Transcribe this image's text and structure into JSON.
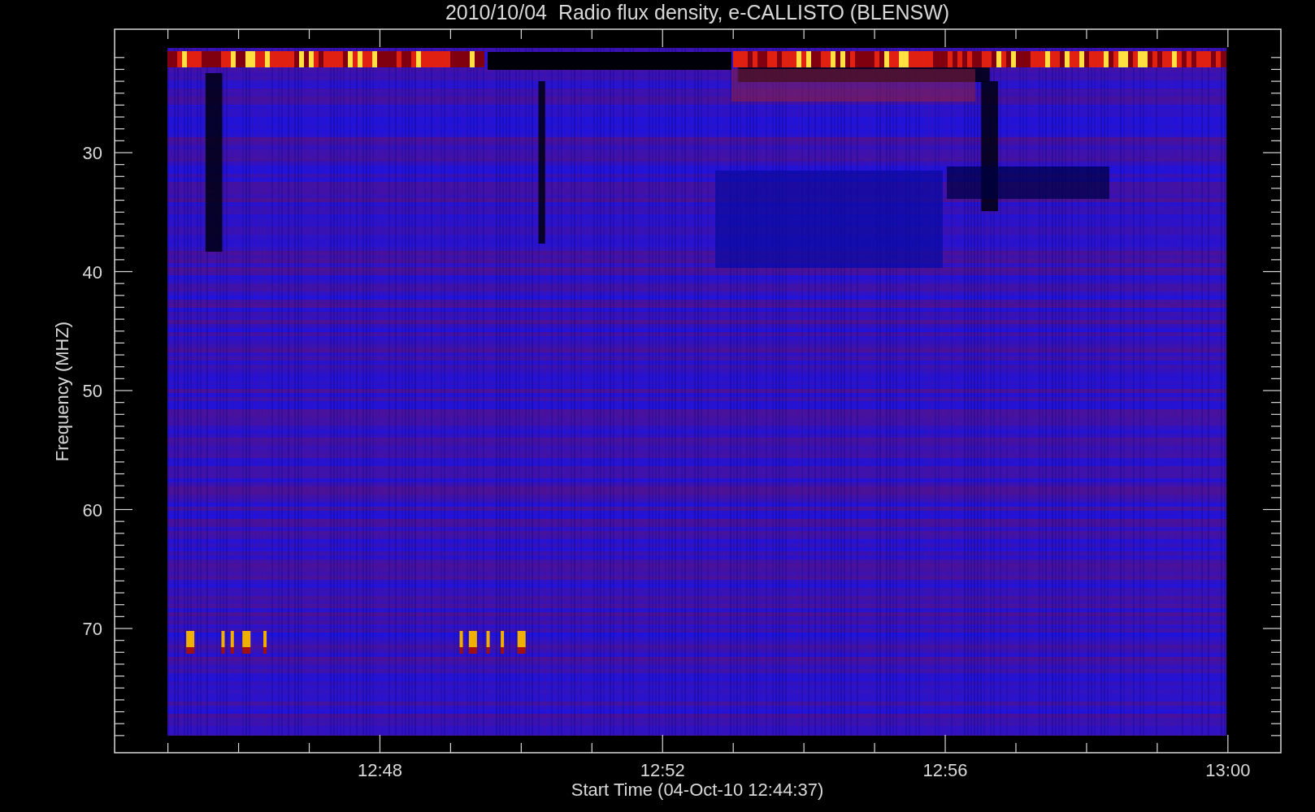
{
  "title": "2010/10/04  Radio flux density, e-CALLISTO (BLENSW)",
  "y_axis": {
    "label": "Frequency (MHZ)",
    "ticks": [
      "30",
      "40",
      "50",
      "60",
      "70"
    ]
  },
  "x_axis": {
    "label": "Start Time (04-Oct-10 12:44:37)",
    "ticks": [
      "12:48",
      "12:52",
      "12:56",
      "13:00"
    ]
  }
}
